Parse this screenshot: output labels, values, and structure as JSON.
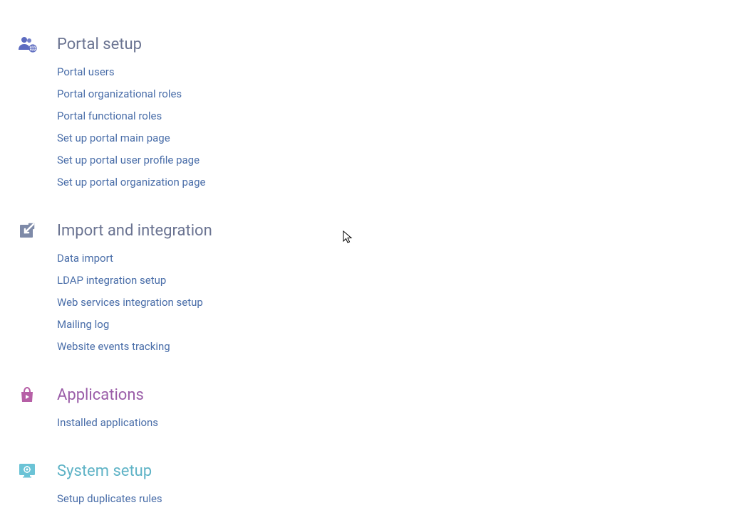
{
  "sections": [
    {
      "id": "portal-setup",
      "title": "Portal setup",
      "titleClass": "",
      "icon": "portal-users-icon",
      "items": [
        "Portal users",
        "Portal organizational roles",
        "Portal functional roles",
        "Set up portal main page",
        "Set up portal user profile page",
        "Set up portal organization page"
      ]
    },
    {
      "id": "import-integration",
      "title": "Import and integration",
      "titleClass": "",
      "icon": "import-icon",
      "items": [
        "Data import",
        "LDAP integration setup",
        "Web services integration setup",
        "Mailing log",
        "Website events tracking"
      ]
    },
    {
      "id": "applications",
      "title": "Applications",
      "titleClass": "purple",
      "icon": "shopping-bag-icon",
      "items": [
        "Installed applications"
      ]
    },
    {
      "id": "system-setup",
      "title": "System setup",
      "titleClass": "teal",
      "icon": "monitor-gear-icon",
      "items": [
        "Setup duplicates rules"
      ]
    }
  ]
}
